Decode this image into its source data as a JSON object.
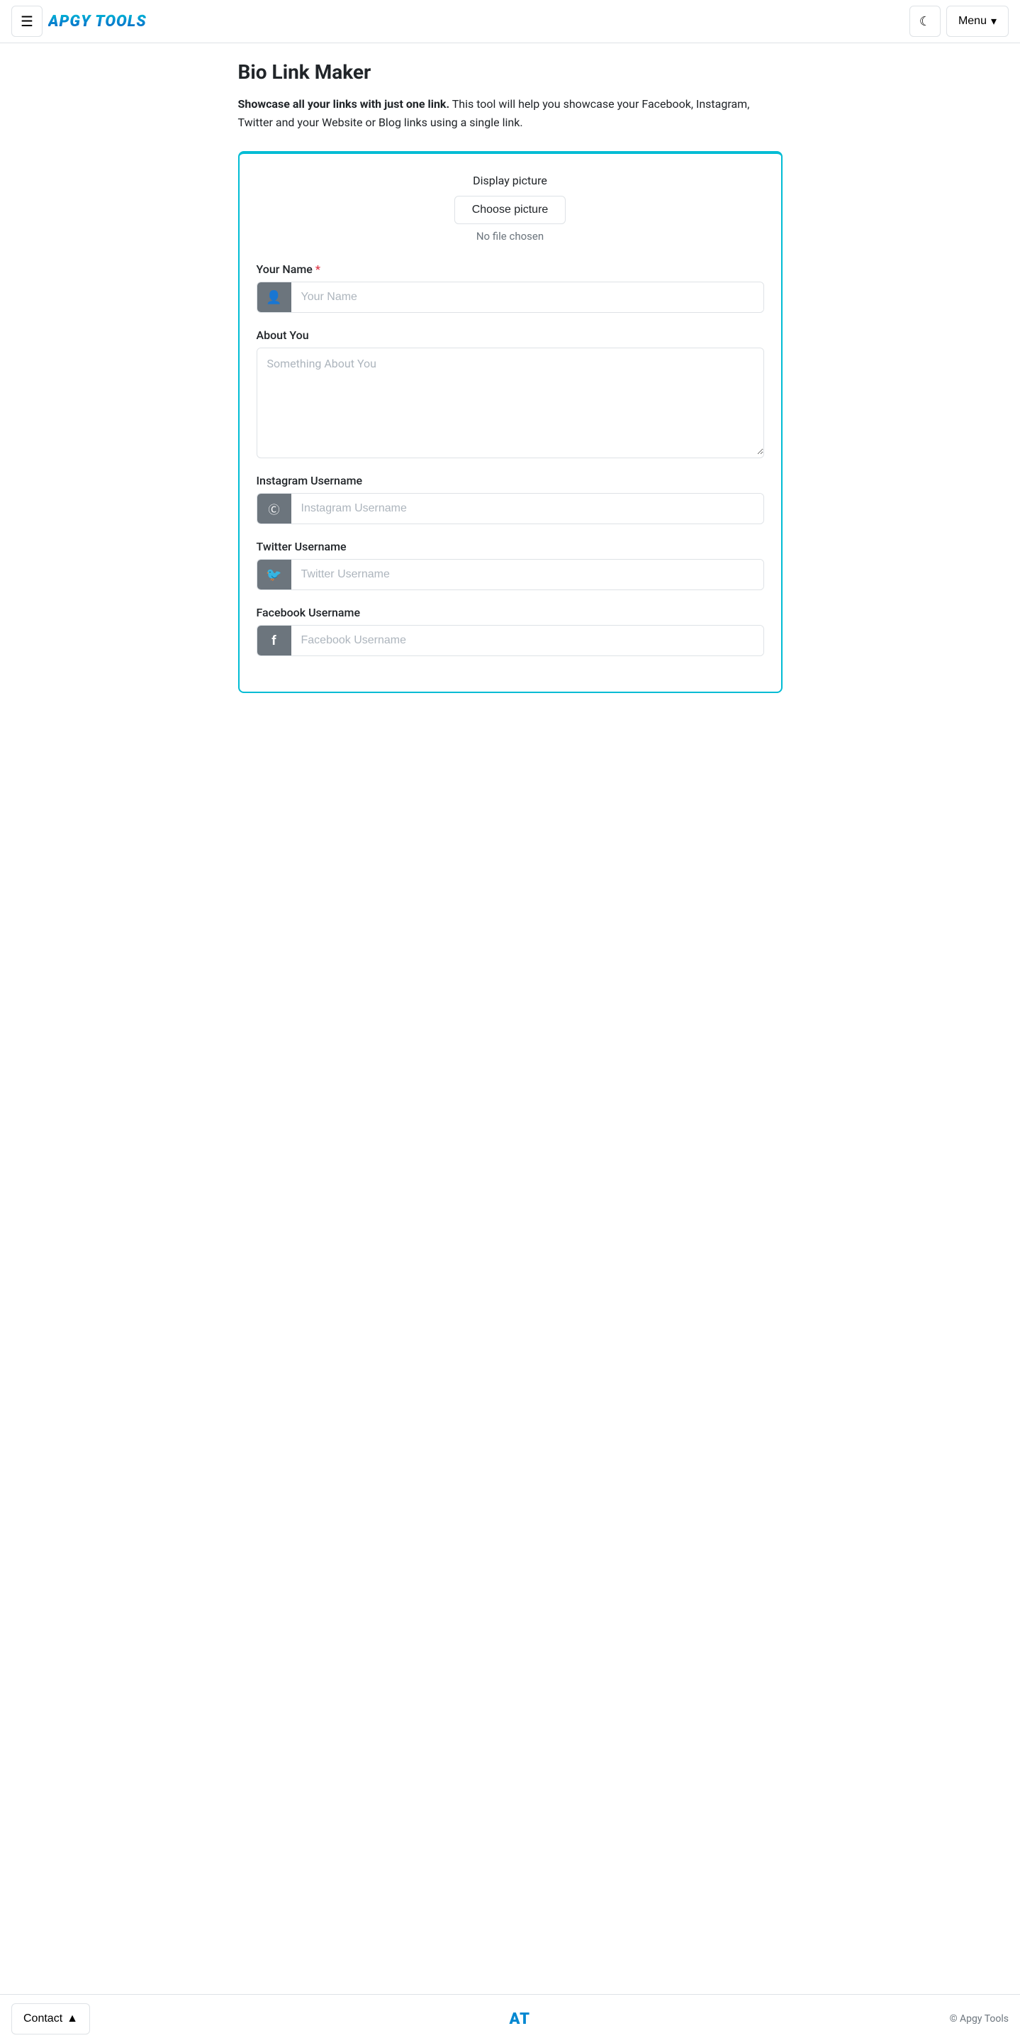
{
  "header": {
    "logo": "APGY TOOLS",
    "menu_label": "Menu",
    "menu_arrow": "▾"
  },
  "page": {
    "title": "Bio Link Maker",
    "description_bold": "Showcase all your links with just one link.",
    "description_rest": " This tool will help you showcase your Facebook, Instagram, Twitter and your Website or Blog links using a single link."
  },
  "form": {
    "display_picture_label": "Display picture",
    "choose_picture_btn": "Choose picture",
    "no_file_text": "No file chosen",
    "your_name_label": "Your Name",
    "your_name_required": "*",
    "your_name_placeholder": "Your Name",
    "about_you_label": "About You",
    "about_you_placeholder": "Something About You",
    "instagram_label": "Instagram Username",
    "instagram_placeholder": "Instagram Username",
    "twitter_label": "Twitter Username",
    "twitter_placeholder": "Twitter Username",
    "facebook_label": "Facebook Username",
    "facebook_placeholder": "Facebook Username"
  },
  "footer": {
    "contact_label": "Contact",
    "contact_arrow": "▲",
    "logo": "AT",
    "copyright": "© Apgy Tools"
  },
  "icons": {
    "hamburger": "☰",
    "moon": "☾",
    "person": "👤",
    "instagram": "📷",
    "twitter": "🐦",
    "facebook": "f"
  }
}
